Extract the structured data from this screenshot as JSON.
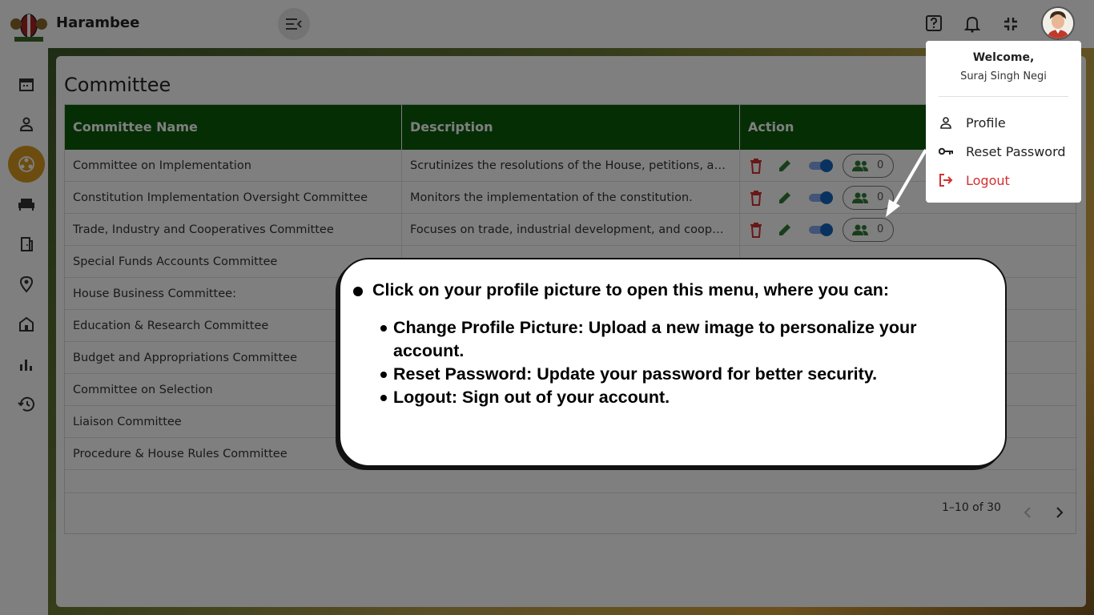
{
  "app": {
    "title": "Harambee"
  },
  "page": {
    "title": "Committee"
  },
  "table": {
    "headers": [
      "Committee Name",
      "Description",
      "Action"
    ],
    "rows": [
      {
        "name": "Committee on Implementation",
        "description": "Scrutinizes the resolutions of the House, petitions, and ...",
        "members": "0"
      },
      {
        "name": "Constitution Implementation Oversight Committee",
        "description": "Monitors the implementation of the constitution.",
        "members": "0"
      },
      {
        "name": "Trade, Industry and Cooperatives Committee",
        "description": "Focuses on trade, industrial development, and cooper...",
        "members": "0"
      },
      {
        "name": "Special Funds Accounts Committee",
        "description": "",
        "members": ""
      },
      {
        "name": "House Business Committee:",
        "description": "",
        "members": ""
      },
      {
        "name": "Education & Research Committee",
        "description": "",
        "members": ""
      },
      {
        "name": "Budget and Appropriations Committee",
        "description": "",
        "members": ""
      },
      {
        "name": "Committee on Selection",
        "description": "",
        "members": ""
      },
      {
        "name": "Liaison Committee",
        "description": "",
        "members": ""
      },
      {
        "name": "Procedure & House Rules Committee",
        "description": "",
        "members": ""
      }
    ]
  },
  "pagination": {
    "range": "1–10 of 30"
  },
  "profile_menu": {
    "welcome": "Welcome,",
    "user_name": "Suraj Singh Negi",
    "items": [
      {
        "label": "Profile",
        "icon": "person-icon"
      },
      {
        "label": "Reset Password",
        "icon": "key-icon"
      },
      {
        "label": "Logout",
        "icon": "logout-icon"
      }
    ]
  },
  "callout": {
    "main": "Click on your profile picture to open this menu, where you can:",
    "bullets": [
      "Change Profile Picture: Upload a new image to personalize your account.",
      "Reset Password: Update your password for better security.",
      "Logout: Sign out of your account."
    ]
  },
  "colors": {
    "header_green": "#0a5c0a",
    "accent_gold": "#d99a1f",
    "danger_red": "#d32f2f",
    "toggle_blue": "#1565c0",
    "edit_green": "#2e7d32"
  },
  "icons": {
    "topbar": [
      "help-icon",
      "bell-icon",
      "collapse-icon"
    ],
    "sidebar": [
      "calendar-icon",
      "person-icon",
      "committee-icon",
      "sofa-icon",
      "door-icon",
      "location-icon",
      "building-icon",
      "bar-chart-icon",
      "history-icon"
    ]
  }
}
